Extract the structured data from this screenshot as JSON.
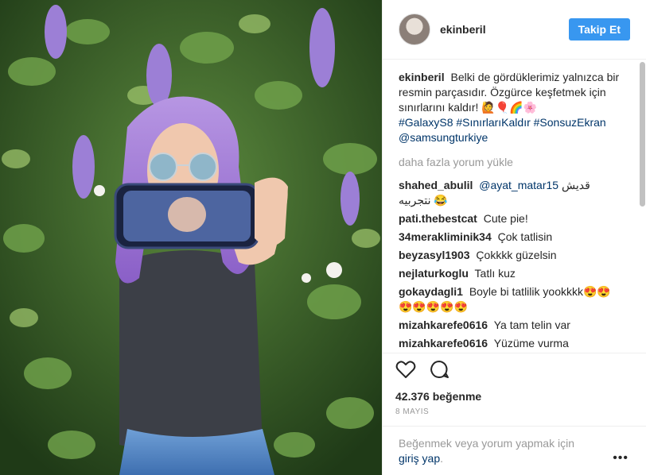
{
  "header": {
    "username": "ekinberil",
    "follow_label": "Takip Et"
  },
  "caption": {
    "username": "ekinberil",
    "text": "Belki de gördüklerimiz yalnızca bir resmin parçasıdır. Özgürce keşfetmek için sınırlarını kaldır! 🙋🎈🌈🌸",
    "hashtags": [
      "#GalaxyS8",
      "#SınırlarıKaldır",
      "#SonsuzEkran"
    ],
    "mention": "@samsungturkiye"
  },
  "load_more": "daha fazla yorum yükle",
  "comments": [
    {
      "user": "shahed_abulil",
      "mention": "@ayat_matar15",
      "text": "قديش نتجربيه 😂"
    },
    {
      "user": "pati.thebestcat",
      "mention": "",
      "text": "Cute pie!"
    },
    {
      "user": "34meraklimin‌ik34",
      "mention": "",
      "text": "Çok tatlisin"
    },
    {
      "user": "beyzasyl1903",
      "mention": "",
      "text": "Çokkkk güzelsin"
    },
    {
      "user": "nejlaturkoglu",
      "mention": "",
      "text": "Tatlı kuz"
    },
    {
      "user": "gokaydagli1",
      "mention": "",
      "text": "Boyle bi tatlilik yookkkk😍😍😍😍😍😍😍"
    },
    {
      "user": "mizahkarefe0616",
      "mention": "",
      "text": "Ya tam telin var"
    },
    {
      "user": "mizahkarefe0616",
      "mention": "",
      "text": "Yüzüme vurma"
    }
  ],
  "likes": "42.376 beğenme",
  "date": "8 MAYIS",
  "footer": {
    "text": "Beğenmek veya yorum yapmak için",
    "login_link": "giriş yap",
    "suffix": ".",
    "more": "•••"
  },
  "icons": {
    "like": "heart-icon",
    "comment": "comment-bubble-icon"
  },
  "colors": {
    "accent": "#3897f0",
    "link": "#003569",
    "muted": "#999999"
  }
}
